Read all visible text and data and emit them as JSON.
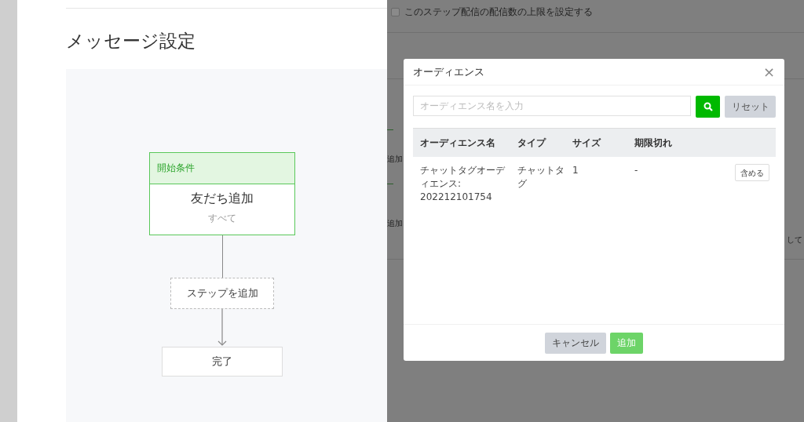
{
  "page": {
    "title": "メッセージ設定"
  },
  "flow": {
    "start_header": "開始条件",
    "start_title": "友だち追加",
    "start_sub": "すべて",
    "add_step": "ステップを追加",
    "end": "完了"
  },
  "background": {
    "limit_checkbox": {
      "label": "このステップ配信の配信数の上限を設定する",
      "checked": false
    },
    "fragments": [
      "追加",
      "追加",
      "して"
    ]
  },
  "dialog": {
    "title": "オーディエンス",
    "close": "×",
    "search": {
      "placeholder": "オーディエンス名を入力"
    },
    "reset": "リセット",
    "table": {
      "columns": [
        "オーディエンス名",
        "タイプ",
        "サイズ",
        "期限切れ"
      ],
      "rows": [
        {
          "name": "チャットタグオーディエンス: 202212101754",
          "type": "チャットタグ",
          "size": "1",
          "expiry": "-",
          "action": "含める"
        }
      ]
    },
    "buttons": [
      {
        "label": "キャンセル",
        "kind": "cancel"
      },
      {
        "label": "追加",
        "kind": "primary",
        "disabled": true
      }
    ]
  }
}
